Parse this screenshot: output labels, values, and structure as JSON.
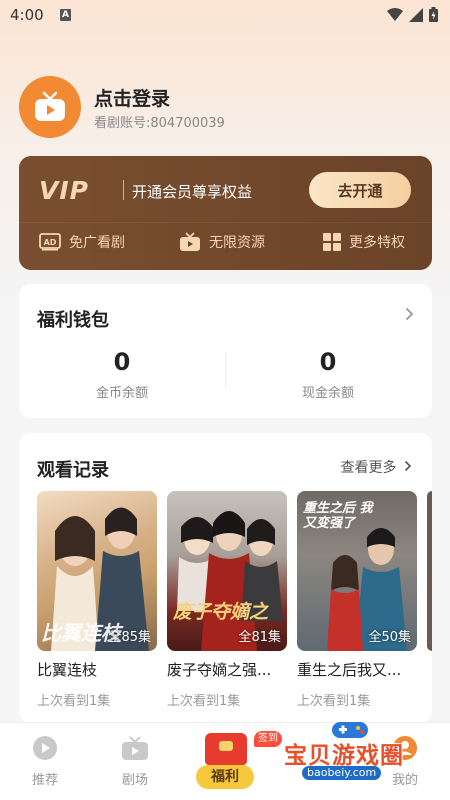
{
  "status_bar": {
    "time": "4:00",
    "notification_letter": "A"
  },
  "profile": {
    "login_prompt": "点击登录",
    "account_label": "看剧账号:804700039"
  },
  "vip": {
    "logo": "VIP",
    "slogan": "开通会员尊享权益",
    "button_label": "去开通",
    "benefits": [
      {
        "icon": "ad-icon",
        "label": "免广看剧"
      },
      {
        "icon": "tv-play-icon",
        "label": "无限资源"
      },
      {
        "icon": "grid-icon",
        "label": "更多特权"
      }
    ]
  },
  "wallet": {
    "title": "福利钱包",
    "coin_value": "0",
    "coin_label": "金币余额",
    "cash_value": "0",
    "cash_label": "现金余额"
  },
  "history": {
    "title": "观看记录",
    "more_label": "查看更多",
    "items": [
      {
        "title": "比翼连枝",
        "episodes": "全85集",
        "progress": "上次看到1集",
        "poster_text": "比翼连枝"
      },
      {
        "title": "废子夺嫡之强...",
        "episodes": "全81集",
        "progress": "上次看到1集",
        "poster_text": "废子夺嫡之"
      },
      {
        "title": "重生之后我又...",
        "episodes": "全50集",
        "progress": "上次看到1集",
        "poster_text": "重生之后 我又变强了"
      }
    ]
  },
  "nav": {
    "items": [
      {
        "icon": "play-circle-icon",
        "label": "推荐"
      },
      {
        "icon": "tv-icon",
        "label": "剧场"
      },
      {
        "icon": "red-envelope-icon",
        "label": "福利",
        "badge": "签到"
      },
      {
        "icon": "user-icon",
        "label": "我的"
      }
    ]
  },
  "watermark": {
    "title": "宝贝游戏圈",
    "url": "baobeiy.com"
  },
  "colors": {
    "accent_orange": "#f28a33",
    "vip_brown": "#7a4f31",
    "vip_gold": "#f3cf9e",
    "welfare_yellow": "#f6c93d"
  }
}
